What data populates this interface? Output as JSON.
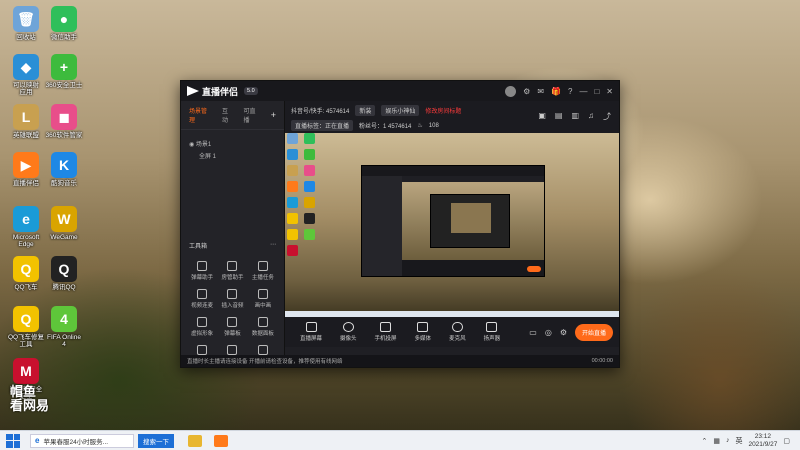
{
  "desktop": {
    "icons": [
      {
        "label": "回收站",
        "glyph": "🗑",
        "color": "#6ea4d8"
      },
      {
        "label": "微信助手",
        "glyph": "●",
        "color": "#2fbf5a"
      },
      {
        "label": "可以映射\n应用",
        "glyph": "◆",
        "color": "#2a8fd6"
      },
      {
        "label": "360安全卫士",
        "glyph": "+",
        "color": "#3dbb3d"
      },
      {
        "label": "英雄联盟",
        "glyph": "L",
        "color": "#c8a050"
      },
      {
        "label": "360软件管家",
        "glyph": "◼",
        "color": "#e84e8a"
      },
      {
        "label": "直播伴侣",
        "glyph": "▶",
        "color": "#ff7a1a"
      },
      {
        "label": "酷狗音乐",
        "glyph": "K",
        "color": "#1e88e5"
      },
      {
        "label": "Microsoft\nEdge",
        "glyph": "e",
        "color": "#1a9bd7"
      },
      {
        "label": "WeGame",
        "glyph": "W",
        "color": "#d9a400"
      },
      {
        "label": "QQ飞车",
        "glyph": "Q",
        "color": "#f2c200"
      },
      {
        "label": "腾讯QQ",
        "glyph": "Q",
        "color": "#222"
      },
      {
        "label": "QQ飞车修复\n工具",
        "glyph": "Q",
        "color": "#f2c200"
      },
      {
        "label": "FIFA Online\n4",
        "glyph": "4",
        "color": "#5ec63a"
      },
      {
        "label": "迈克菲安全\n卫士",
        "glyph": "M",
        "color": "#c8102e"
      }
    ],
    "watermark": "帽鱼\n看网易"
  },
  "app": {
    "logo": "直播伴侣",
    "version": "5.0",
    "left_tabs": [
      "场景管理",
      "互动",
      "可直播"
    ],
    "add": "+",
    "scene_items": [
      "◉ 场景1",
      "全屏 1"
    ],
    "tools_header": "工具箱",
    "tools": [
      "弹幕助手",
      "房管助手",
      "主播任务",
      "视频连麦",
      "插入音频",
      "画中画",
      "虚拟形象",
      "弹幕板",
      "数据面板",
      "动态特效",
      "装饰",
      "截图"
    ],
    "info_id": "抖音号/快手: 4574614",
    "info_pill1": "新装",
    "info_pill2": "娱乐小神仙",
    "info_red": "修改房间标题",
    "info_row2_tag": "直播标签：正在直播",
    "info_row2_fans": "粉丝号：1    4574614",
    "info_row2_count": "108",
    "controls": [
      "直播屏幕",
      "摄像头",
      "手机投屏",
      "多媒体",
      "麦克风",
      "扬声器"
    ],
    "live_button": "开始直播",
    "status_text": "直播时长主播请连接设备 开播前请检查设备，推荐使用有线网络",
    "status_time": "00:00:00"
  },
  "taskbar": {
    "search_text": "苹果春服24小时服务...",
    "search_button": "搜索一下",
    "time": "23:12",
    "date": "2021/9/27",
    "ime": "英"
  }
}
